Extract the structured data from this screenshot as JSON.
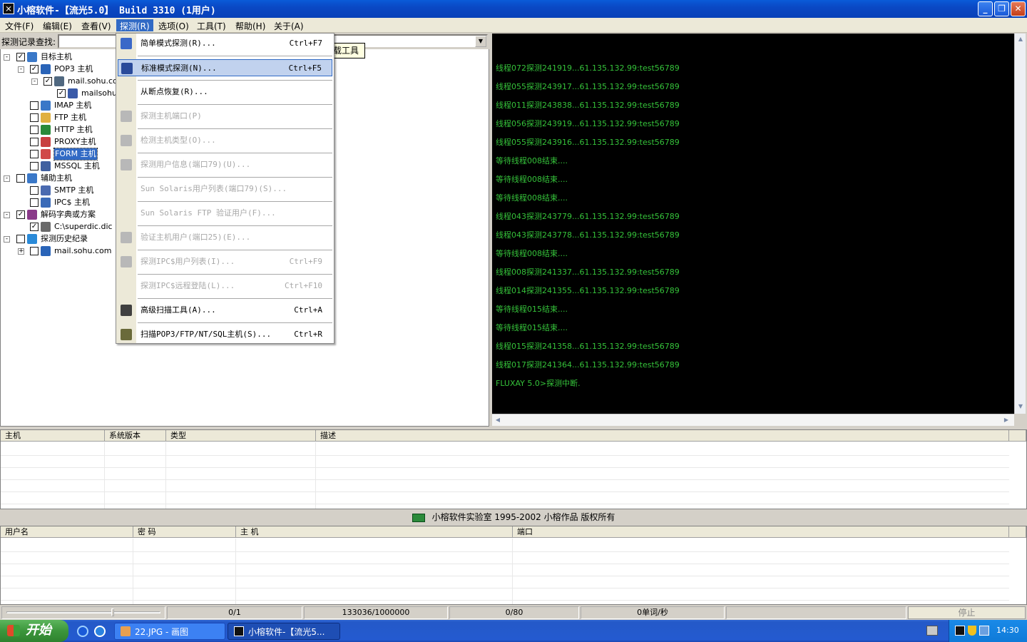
{
  "window": {
    "title": "小榕软件-【流光5.0】 Build 3310 (1用户)",
    "min_label": "_",
    "max_label": "❐",
    "close_label": "✕"
  },
  "menubar": [
    {
      "label": "文件(F)"
    },
    {
      "label": "编辑(E)"
    },
    {
      "label": "查看(V)"
    },
    {
      "label": "探测(R)"
    },
    {
      "label": "选项(O)"
    },
    {
      "label": "工具(T)"
    },
    {
      "label": "帮助(H)"
    },
    {
      "label": "关于(A)"
    }
  ],
  "search": {
    "label": "探测记录查找:",
    "value": ""
  },
  "tooltip": "载工具",
  "tree": [
    {
      "label": "目标主机",
      "checked": true,
      "expand": "-"
    },
    {
      "label": "POP3 主机",
      "checked": true,
      "expand": "-"
    },
    {
      "label": "mail.sohu.com",
      "checked": true,
      "expand": "-"
    },
    {
      "label": "mailsohu1",
      "checked": true,
      "expand": ""
    },
    {
      "label": "IMAP 主机",
      "checked": false,
      "expand": ""
    },
    {
      "label": "FTP 主机",
      "checked": false,
      "expand": ""
    },
    {
      "label": "HTTP 主机",
      "checked": false,
      "expand": ""
    },
    {
      "label": "PROXY主机",
      "checked": false,
      "expand": ""
    },
    {
      "label": "FORM 主机",
      "checked": false,
      "expand": "",
      "selected": true
    },
    {
      "label": "MSSQL 主机",
      "checked": false,
      "expand": ""
    },
    {
      "label": "辅助主机",
      "checked": false,
      "expand": "-"
    },
    {
      "label": "SMTP 主机",
      "checked": false,
      "expand": ""
    },
    {
      "label": "IPC$ 主机",
      "checked": false,
      "expand": ""
    },
    {
      "label": "解码字典或方案",
      "checked": true,
      "expand": "-"
    },
    {
      "label": "C:\\superdic.dic",
      "checked": true,
      "expand": ""
    },
    {
      "label": "探测历史纪录",
      "checked": false,
      "expand": "-"
    },
    {
      "label": "mail.sohu.com",
      "checked": false,
      "expand": "+"
    }
  ],
  "probe_menu": [
    {
      "label": "简单模式探测(R)...",
      "shortcut": "Ctrl+F7",
      "disabled": false,
      "icon": "wand-icon"
    },
    {
      "label": "标准模式探测(N)...",
      "shortcut": "Ctrl+F5",
      "disabled": false,
      "icon": "magic-icon",
      "highlighted": true
    },
    {
      "label": "从断点恢复(R)...",
      "shortcut": "",
      "disabled": false,
      "icon": ""
    },
    {
      "label": "探测主机端口(P)",
      "shortcut": "",
      "disabled": true,
      "icon": "port-icon"
    },
    {
      "label": "检测主机类型(O)...",
      "shortcut": "",
      "disabled": true,
      "icon": "os-icon"
    },
    {
      "label": "探测用户信息(端口79)(U)...",
      "shortcut": "",
      "disabled": true,
      "icon": "user-icon"
    },
    {
      "label": "Sun Solaris用户列表(端口79)(S)...",
      "shortcut": "",
      "disabled": true,
      "icon": ""
    },
    {
      "label": "Sun Solaris FTP 验证用户(F)...",
      "shortcut": "",
      "disabled": true,
      "icon": ""
    },
    {
      "label": "验证主机用户(端口25)(E)...",
      "shortcut": "",
      "disabled": true,
      "icon": "mail-icon"
    },
    {
      "label": "探测IPC$用户列表(I)...",
      "shortcut": "Ctrl+F9",
      "disabled": true,
      "icon": "ipc-icon"
    },
    {
      "label": "探测IPC$远程登陆(L)...",
      "shortcut": "Ctrl+F10",
      "disabled": true,
      "icon": ""
    },
    {
      "label": "高级扫描工具(A)...",
      "shortcut": "Ctrl+A",
      "disabled": false,
      "icon": "binoculars-icon"
    },
    {
      "label": "扫描POP3/FTP/NT/SQL主机(S)...",
      "shortcut": "Ctrl+R",
      "disabled": false,
      "icon": "scan-icon"
    }
  ],
  "console_lines": [
    "线程072探测241919...61.135.132.99:test56789",
    "线程055探测243917...61.135.132.99:test56789",
    "线程011探测243838...61.135.132.99:test56789",
    "线程056探测243919...61.135.132.99:test56789",
    "线程055探测243916...61.135.132.99:test56789",
    "等待线程008结束....",
    "等待线程008结束....",
    "等待线程008结束....",
    "线程043探测243779...61.135.132.99:test56789",
    "线程043探测243778...61.135.132.99:test56789",
    "等待线程008结束....",
    "线程008探测241337...61.135.132.99:test56789",
    "线程014探测241355...61.135.132.99:test56789",
    "等待线程015结束....",
    "等待线程015结束....",
    "线程015探测241358...61.135.132.99:test56789",
    "线程017探测241364...61.135.132.99:test56789",
    "FLUXAY 5.0>探测中断."
  ],
  "hosts_table": {
    "columns": [
      "主机",
      "系统版本",
      "类型",
      "描述"
    ]
  },
  "copyright": "小榕软件实验室 1995-2002 小榕作品 版权所有",
  "results_table": {
    "columns": [
      "用户名",
      "密 码",
      "主 机",
      "端口"
    ]
  },
  "status": {
    "progress": 0.0,
    "cells": [
      "0/1",
      "133036/1000000",
      "0/80",
      "0单词/秒"
    ],
    "stop": "停止"
  },
  "taskbar": {
    "start": "开始",
    "tasks": [
      {
        "label": "22.JPG - 画图",
        "active": false
      },
      {
        "label": "小榕软件-【流光5...",
        "active": true
      }
    ],
    "clock": "14:30"
  },
  "colors": {
    "console_text": "#35c23a",
    "selection": "#316ac5",
    "titlebar": "#0a48c4"
  }
}
